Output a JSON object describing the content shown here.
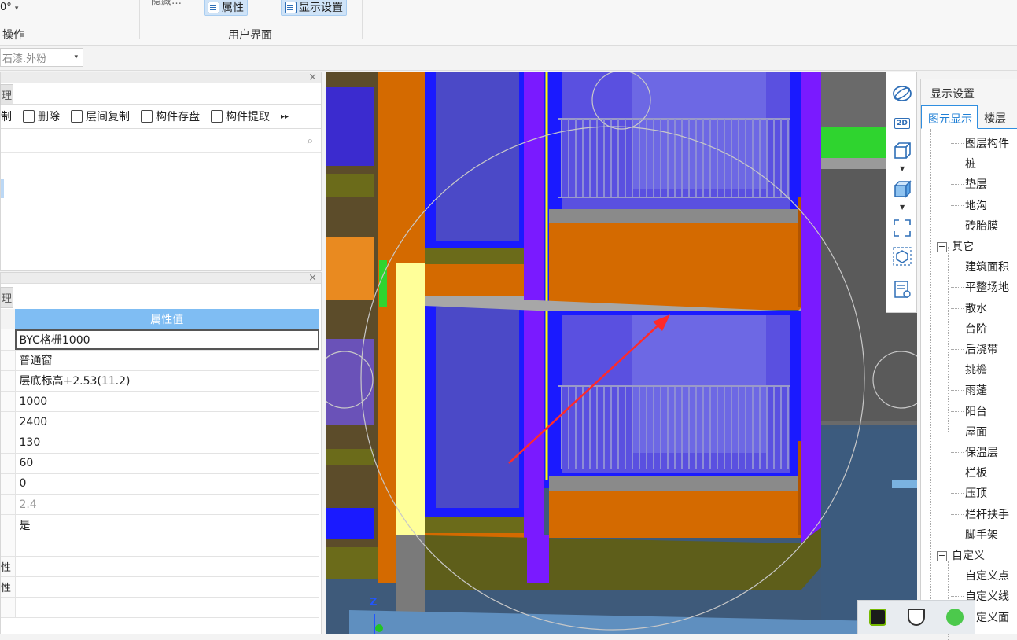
{
  "ribbon": {
    "angle_label": "0°",
    "operate_group_label": "操作",
    "partial_label": "隐藏…",
    "attribute_button": "属性",
    "display_settings_button": "显示设置",
    "user_interface_group_label": "用户界面"
  },
  "toolbar2": {
    "material_select_value": "石漆.外粉"
  },
  "left_top_panel": {
    "tab_stub": "理",
    "tools": {
      "copy_partial": "制",
      "delete": "删除",
      "floor_copy": "层间复制",
      "component_save": "构件存盘",
      "component_extract": "构件提取"
    }
  },
  "property_panel": {
    "tab_stub": "理",
    "header_value": "属性值",
    "rows": [
      {
        "key": "",
        "value": "BYC格栅1000",
        "muted": false
      },
      {
        "key": "",
        "value": "普通窗",
        "muted": false
      },
      {
        "key": "",
        "value": "层底标高+2.53(11.2)",
        "muted": false
      },
      {
        "key": "",
        "value": "1000",
        "muted": false
      },
      {
        "key": "",
        "value": "2400",
        "muted": false
      },
      {
        "key": "",
        "value": "130",
        "muted": false
      },
      {
        "key": "",
        "value": "60",
        "muted": false
      },
      {
        "key": "",
        "value": "0",
        "muted": false
      },
      {
        "key": "",
        "value": "2.4",
        "muted": true
      },
      {
        "key": "",
        "value": "是",
        "muted": false
      },
      {
        "key": "",
        "value": "",
        "muted": false
      },
      {
        "key": "性",
        "value": "",
        "muted": false
      },
      {
        "key": "性",
        "value": "",
        "muted": false
      },
      {
        "key": "",
        "value": "",
        "muted": false
      }
    ]
  },
  "viewport": {
    "axis_label_z": "Z",
    "view_tools": {
      "label_2d": "2D"
    }
  },
  "right_panel": {
    "title": "显示设置",
    "tabs": [
      "图元显示",
      "楼层"
    ],
    "tree": {
      "layer_header": "图层构件",
      "items_a": [
        "桩",
        "垫层",
        "地沟",
        "砖胎膜"
      ],
      "group_other": "其它",
      "items_b": [
        "建筑面积",
        "平整场地",
        "散水",
        "台阶",
        "后浇带",
        "挑檐",
        "雨蓬",
        "阳台",
        "屋面",
        "保温层",
        "栏板",
        "压顶",
        "栏杆扶手",
        "脚手架"
      ],
      "group_custom": "自定义",
      "items_c": [
        "自定义点",
        "自定义线",
        "自定义面"
      ]
    }
  },
  "colors": {
    "orange_wall": "#d46a00",
    "blue_window": "#1a1aff",
    "purple_column": "#7a1aff",
    "olive_band": "#5e5e1a",
    "arrow_red": "#ff2a2a",
    "header_blue": "#7fbdf3"
  }
}
